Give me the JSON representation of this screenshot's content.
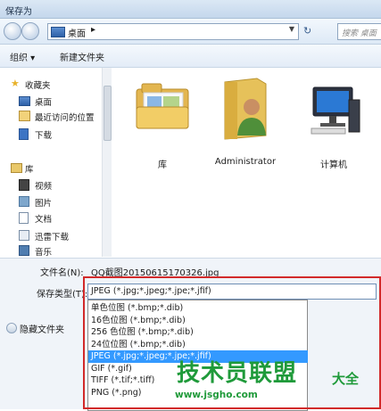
{
  "window": {
    "title": "保存为"
  },
  "address_bar": {
    "location": "桌面",
    "separator": "▸"
  },
  "search": {
    "placeholder": "搜索 桌面"
  },
  "toolbar": {
    "organize_label": "组织 ▾",
    "new_folder_label": "新建文件夹"
  },
  "sidebar": {
    "items": [
      {
        "label": "收藏夹",
        "icon": "star-icon",
        "header": true
      },
      {
        "label": "桌面",
        "icon": "desktop-icon"
      },
      {
        "label": "最近访问的位置",
        "icon": "recent-places-icon"
      },
      {
        "label": "下载",
        "icon": "download-icon"
      },
      {
        "label": "库",
        "icon": "library-icon",
        "header": true
      },
      {
        "label": "视频",
        "icon": "video-icon"
      },
      {
        "label": "图片",
        "icon": "picture-icon"
      },
      {
        "label": "文档",
        "icon": "document-icon"
      },
      {
        "label": "迅雷下载",
        "icon": "xunlei-download-icon"
      },
      {
        "label": "音乐",
        "icon": "music-icon"
      }
    ]
  },
  "content": {
    "items": [
      {
        "label": "库",
        "icon": "library-folder-icon"
      },
      {
        "label": "Administrator",
        "icon": "user-folder-icon"
      },
      {
        "label": "计算机",
        "icon": "computer-icon"
      }
    ]
  },
  "bottom": {
    "file_name_label": "文件名(N):",
    "file_name_value": "QQ截图20150615170326.jpg",
    "file_type_label": "保存类型(T):",
    "file_type_value": "JPEG (*.jpg;*.jpeg;*.jpe;*.jfif)",
    "hide_folders_label": "隐藏文件夹"
  },
  "file_type_options": [
    {
      "label": "单色位图 (*.bmp;*.dib)"
    },
    {
      "label": "16色位图 (*.bmp;*.dib)"
    },
    {
      "label": "256 色位图 (*.bmp;*.dib)"
    },
    {
      "label": "24位位图 (*.bmp;*.dib)"
    },
    {
      "label": "JPEG (*.jpg;*.jpeg;*.jpe;*.jfif)",
      "selected": true
    },
    {
      "label": "GIF (*.gif)"
    },
    {
      "label": "TIFF (*.tif;*.tiff)"
    },
    {
      "label": "PNG (*.png)"
    }
  ],
  "watermark": {
    "main": "技术员联盟",
    "side": "大全",
    "url": "www.jsgho.com"
  },
  "colors": {
    "selection": "#3399ff",
    "highlight_box": "#d22a2a",
    "watermark": "#1f9a3a"
  }
}
